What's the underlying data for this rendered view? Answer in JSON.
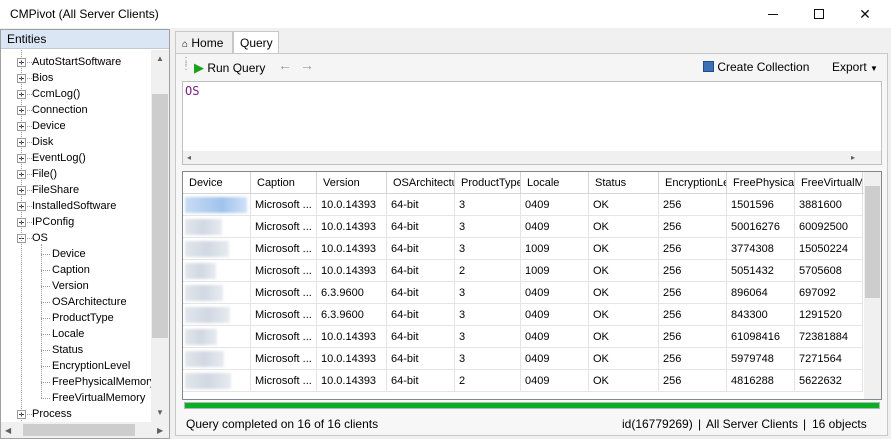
{
  "window": {
    "title": "CMPivot (All Server Clients)"
  },
  "entities": {
    "header": "Entities",
    "items": [
      {
        "label": "AutoStartSoftware",
        "expandable": true,
        "expanded": false
      },
      {
        "label": "Bios",
        "expandable": true,
        "expanded": false
      },
      {
        "label": "CcmLog()",
        "expandable": true,
        "expanded": false
      },
      {
        "label": "Connection",
        "expandable": true,
        "expanded": false
      },
      {
        "label": "Device",
        "expandable": true,
        "expanded": false
      },
      {
        "label": "Disk",
        "expandable": true,
        "expanded": false
      },
      {
        "label": "EventLog()",
        "expandable": true,
        "expanded": false
      },
      {
        "label": "File()",
        "expandable": true,
        "expanded": false
      },
      {
        "label": "FileShare",
        "expandable": true,
        "expanded": false
      },
      {
        "label": "InstalledSoftware",
        "expandable": true,
        "expanded": false
      },
      {
        "label": "IPConfig",
        "expandable": true,
        "expanded": false
      },
      {
        "label": "OS",
        "expandable": true,
        "expanded": true
      },
      {
        "label": "Device",
        "child": true
      },
      {
        "label": "Caption",
        "child": true
      },
      {
        "label": "Version",
        "child": true
      },
      {
        "label": "OSArchitecture",
        "child": true
      },
      {
        "label": "ProductType",
        "child": true
      },
      {
        "label": "Locale",
        "child": true
      },
      {
        "label": "Status",
        "child": true
      },
      {
        "label": "EncryptionLevel",
        "child": true
      },
      {
        "label": "FreePhysicalMemory",
        "child": true
      },
      {
        "label": "FreeVirtualMemory",
        "child": true
      },
      {
        "label": "Process",
        "expandable": true,
        "expanded": false
      }
    ]
  },
  "tabs": [
    {
      "label": "Home",
      "icon": "home-icon",
      "active": false
    },
    {
      "label": "Query",
      "active": true
    }
  ],
  "toolbar": {
    "run_query": "Run Query",
    "create_collection": "Create Collection",
    "export": "Export"
  },
  "editor": {
    "text": "OS"
  },
  "grid": {
    "columns": [
      "Device",
      "Caption",
      "Version",
      "OSArchitecture",
      "ProductType",
      "Locale",
      "Status",
      "EncryptionLevel",
      "FreePhysicalMemory",
      "FreeVirtualMemory"
    ],
    "rows": [
      [
        "",
        "Microsoft ...",
        "10.0.14393",
        "64-bit",
        "3",
        "0409",
        "OK",
        "256",
        "1501596",
        "3881600"
      ],
      [
        "",
        "Microsoft ...",
        "10.0.14393",
        "64-bit",
        "3",
        "0409",
        "OK",
        "256",
        "50016276",
        "60092500"
      ],
      [
        "",
        "Microsoft ...",
        "10.0.14393",
        "64-bit",
        "3",
        "1009",
        "OK",
        "256",
        "3774308",
        "15050224"
      ],
      [
        "",
        "Microsoft ...",
        "10.0.14393",
        "64-bit",
        "2",
        "1009",
        "OK",
        "256",
        "5051432",
        "5705608"
      ],
      [
        "",
        "Microsoft ...",
        "6.3.9600",
        "64-bit",
        "3",
        "0409",
        "OK",
        "256",
        "896064",
        "697092"
      ],
      [
        "",
        "Microsoft ...",
        "6.3.9600",
        "64-bit",
        "3",
        "0409",
        "OK",
        "256",
        "843300",
        "1291520"
      ],
      [
        "",
        "Microsoft ...",
        "10.0.14393",
        "64-bit",
        "3",
        "0409",
        "OK",
        "256",
        "61098416",
        "72381884"
      ],
      [
        "",
        "Microsoft ...",
        "10.0.14393",
        "64-bit",
        "3",
        "0409",
        "OK",
        "256",
        "5979748",
        "7271564"
      ],
      [
        "",
        "Microsoft ...",
        "10.0.14393",
        "64-bit",
        "2",
        "0409",
        "OK",
        "256",
        "4816288",
        "5622632"
      ]
    ]
  },
  "progress": {
    "value": 1.0,
    "color": "#06b025"
  },
  "status": {
    "message": "Query completed on 16 of 16 clients",
    "id": "id(16779269)",
    "collection": "All Server Clients",
    "objects": "16 objects"
  }
}
